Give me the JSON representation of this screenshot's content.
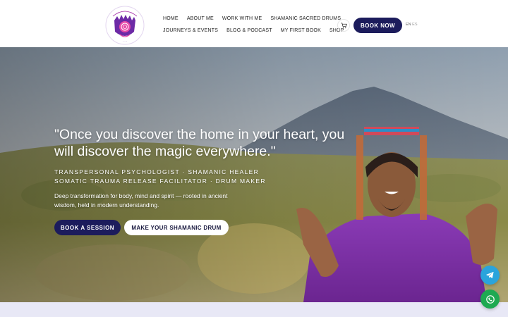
{
  "header": {
    "logo_alt": "Lilly and Ulfa logo",
    "nav_row1": [
      "HOME",
      "ABOUT ME",
      "WORK WITH ME",
      "SHAMANIC SACRED DRUMS"
    ],
    "nav_row2": [
      "JOURNEYS & EVENTS",
      "BLOG & PODCAST",
      "MY FIRST BOOK",
      "SHOP"
    ],
    "cart_icon": "cart-icon",
    "book_now_label": "BOOK NOW",
    "lang_en": "EN",
    "lang_es": "ES"
  },
  "hero": {
    "quote": "\"Once you discover the home in your heart, you will discover the magic everywhere.\"",
    "roles_line1": "TRANSPERSONAL PSYCHOLOGIST · SHAMANIC HEALER",
    "roles_line2": "SOMATIC TRAUMA RELEASE FACILITATOR · DRUM MAKER",
    "description": "Deep transformation for body, mind and spirit — rooted in ancient wisdom, held in modern understanding.",
    "primary_button": "BOOK A SESSION",
    "secondary_button": "MAKE YOUR SHAMANIC DRUM"
  },
  "floating": {
    "telegram_icon": "telegram-icon",
    "whatsapp_icon": "whatsapp-icon"
  },
  "colors": {
    "navy": "#1c1c5c",
    "telegram": "#2aa4dc",
    "whatsapp": "#1ea952",
    "strip": "#e8e8f6"
  }
}
